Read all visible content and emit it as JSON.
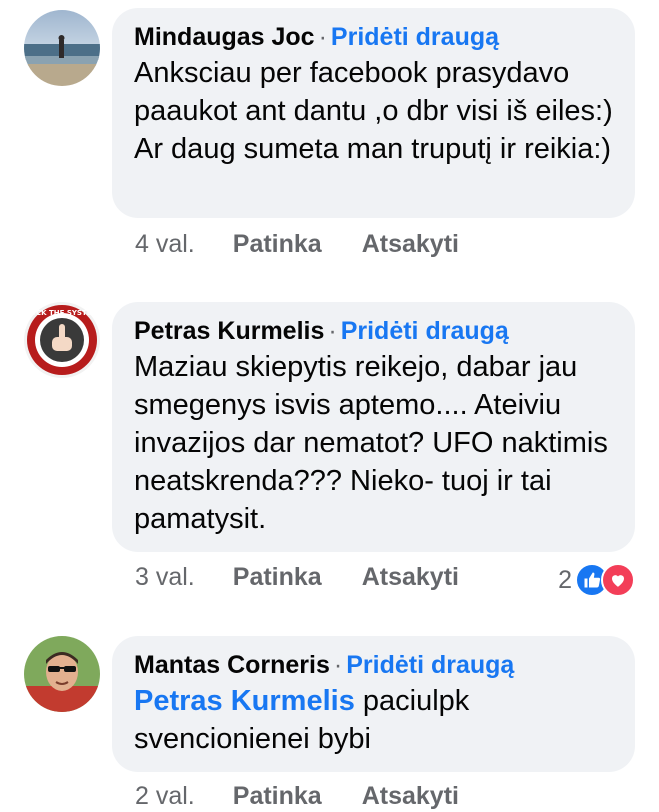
{
  "comments": [
    {
      "author": "Mindaugas Joc",
      "add_friend": "Pridėti draugą",
      "text": "Anksciau per facebook prasydavo paaukot ant dantu ,o dbr visi iš eiles:) Ar daug sumeta man truputį ir reikia:)",
      "time": "4 val.",
      "like": "Patinka",
      "reply": "Atsakyti"
    },
    {
      "author": "Petras Kurmelis",
      "add_friend": "Pridėti draugą",
      "text": "Maziau skiepytis reikejo, dabar jau smegenys isvis aptemo.... Ateiviu invazijos dar nematot? UFO naktimis neatskrenda??? Nieko- tuoj ir tai pamatysit.",
      "avatar_text": "FUCK THE SYSTEM",
      "time": "3 val.",
      "like": "Patinka",
      "reply": "Atsakyti",
      "reaction_count": "2",
      "reaction_icons": [
        "like-icon",
        "love-icon"
      ]
    },
    {
      "author": "Mantas Corneris",
      "add_friend": "Pridėti draugą",
      "mention": "Petras Kurmelis",
      "text": " paciulpk svencionienei bybi",
      "time": "2 val.",
      "like": "Patinka",
      "reply": "Atsakyti"
    }
  ],
  "colors": {
    "link_blue": "#1877f2",
    "bubble_bg": "#f0f2f5",
    "meta_gray": "#65676b",
    "like_blue": "#1877f2",
    "love_red": "#f33e58"
  }
}
